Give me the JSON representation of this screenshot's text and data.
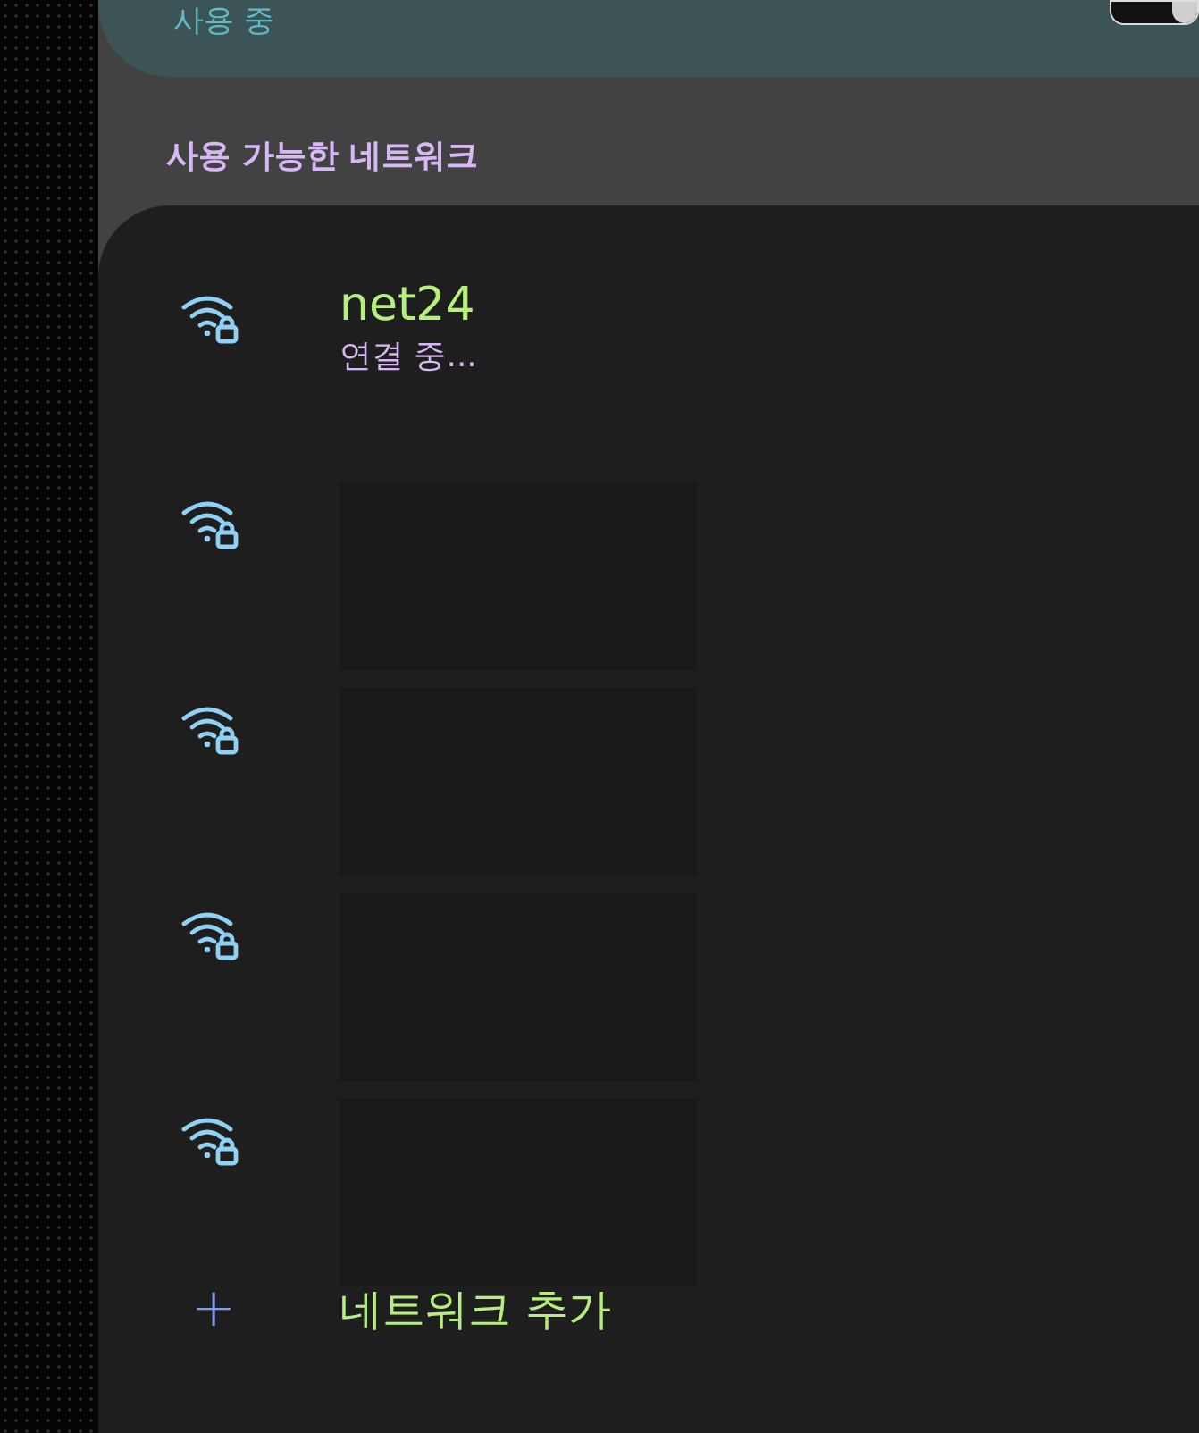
{
  "current_section": {
    "title": "사용 중",
    "toggle_on": true
  },
  "available_header": "사용 가능한 네트워크",
  "networks": [
    {
      "name": "net24",
      "status": "연결 중...",
      "secured": true
    },
    {
      "secured": true
    },
    {
      "secured": true
    },
    {
      "secured": true
    },
    {
      "secured": true
    }
  ],
  "add_network": {
    "icon": "+",
    "label": "네트워크 추가"
  }
}
